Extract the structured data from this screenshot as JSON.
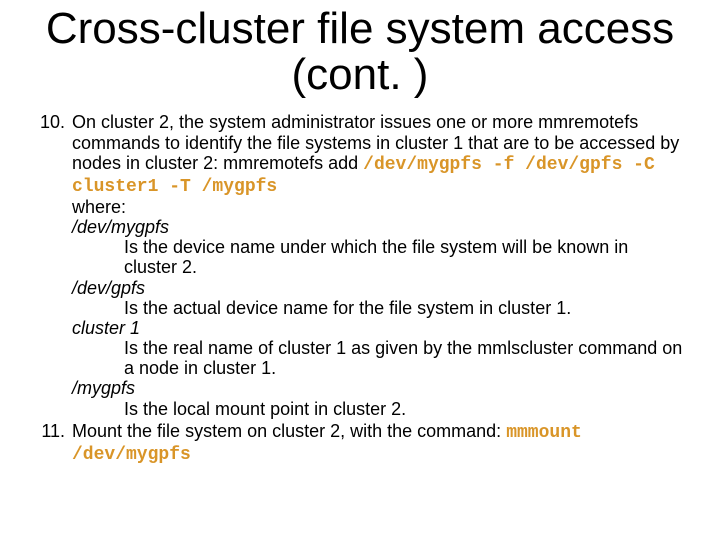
{
  "title": "Cross-cluster file system access (cont. )",
  "list_start": 10,
  "item10_text": "On cluster 2, the system administrator issues one or more mmremotefs commands to identify the file systems in cluster 1 that are to be accessed by nodes in cluster 2: mmremotefs add ",
  "item10_cmd": "/dev/mygpfs -f /dev/gpfs -C cluster1 -T /mygpfs",
  "item10_where": "where:",
  "defs": {
    "d1t": "/dev/mygpfs",
    "d1d": "Is the device name under which the file system will be known in cluster 2.",
    "d2t": "/dev/gpfs",
    "d2d": "Is the actual device name for the file system in cluster 1.",
    "d3t": "cluster 1",
    "d3d": "Is the real name of cluster 1 as given by the mmlscluster command on a node in cluster 1.",
    "d4t": "/mygpfs",
    "d4d": "Is the local mount point in cluster 2."
  },
  "item11_text": "Mount the file system on cluster 2, with the command: ",
  "item11_cmd": "mmmount /dev/mygpfs"
}
